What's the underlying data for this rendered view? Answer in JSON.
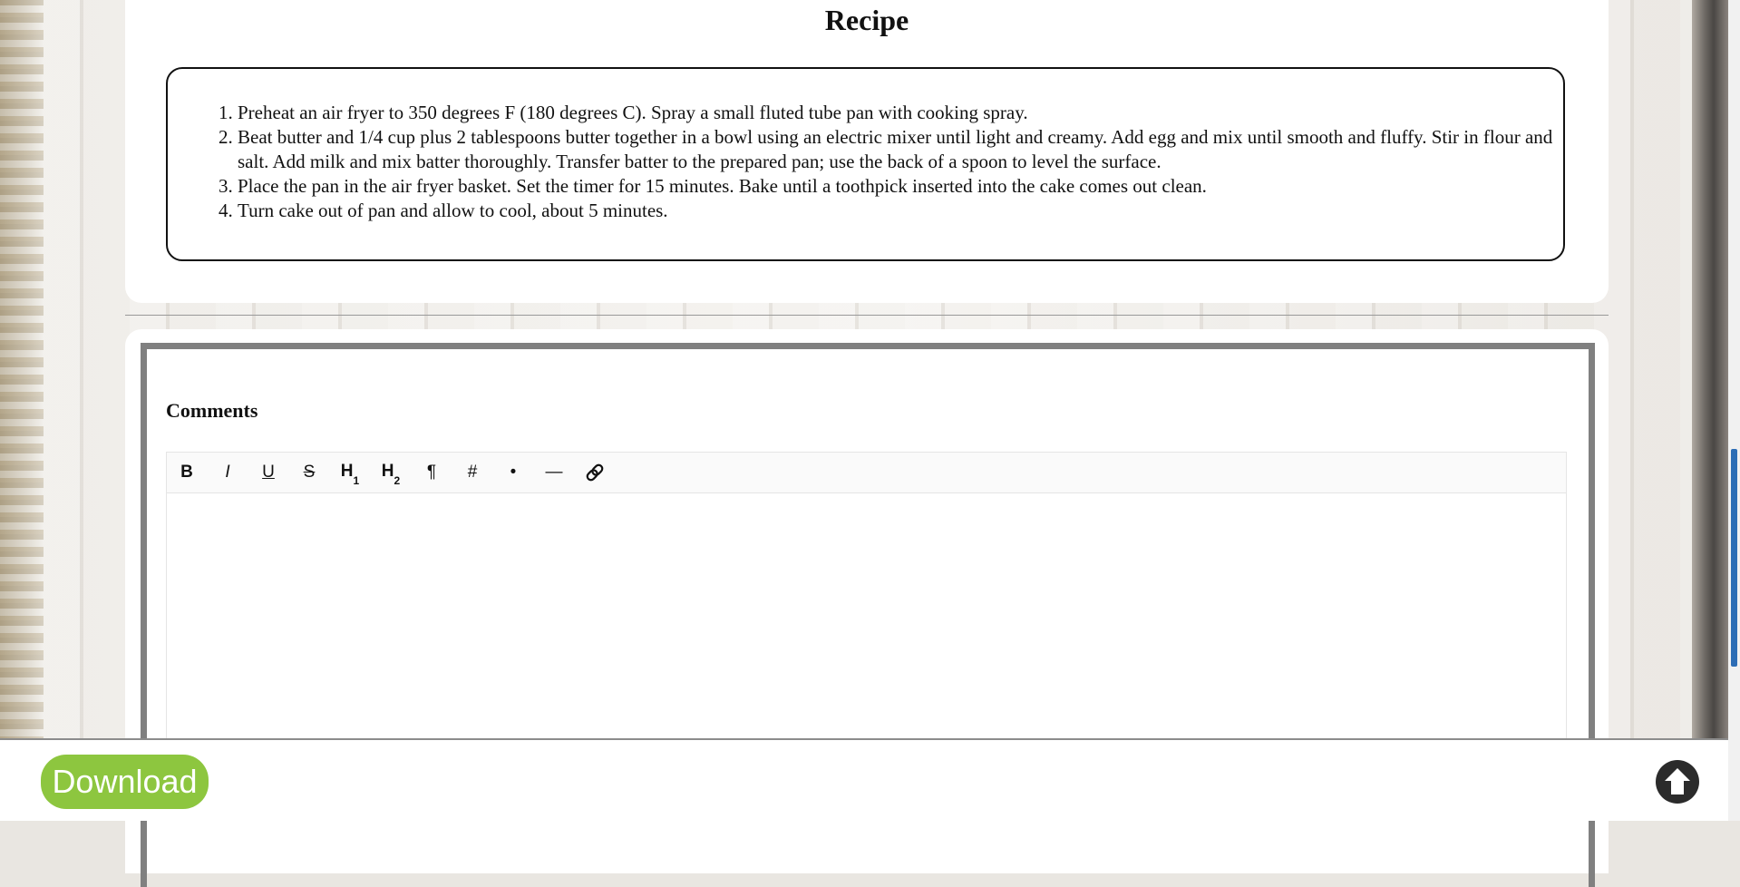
{
  "recipe": {
    "title": "Recipe",
    "steps": [
      "Preheat an air fryer to 350 degrees F (180 degrees C). Spray a small fluted tube pan with cooking spray.",
      "Beat butter and 1/4 cup plus 2 tablespoons butter together in a bowl using an electric mixer until light and creamy. Add egg and mix until smooth and fluffy. Stir in flour and salt. Add milk and mix batter thoroughly. Transfer batter to the prepared pan; use the back of a spoon to level the surface.",
      "Place the pan in the air fryer basket. Set the timer for 15 minutes. Bake until a toothpick inserted into the cake comes out clean.",
      "Turn cake out of pan and allow to cool, about 5 minutes."
    ]
  },
  "comments": {
    "heading": "Comments",
    "toolbar": [
      {
        "name": "bold-button",
        "label": "B",
        "icon": "bold-icon"
      },
      {
        "name": "italic-button",
        "label": "I",
        "icon": "italic-icon"
      },
      {
        "name": "underline-button",
        "label": "U",
        "icon": "underline-icon"
      },
      {
        "name": "strikethrough-button",
        "label": "S",
        "icon": "strikethrough-icon"
      },
      {
        "name": "heading1-button",
        "label": "H",
        "sub": "1",
        "icon": "heading1-icon"
      },
      {
        "name": "heading2-button",
        "label": "H",
        "sub": "2",
        "icon": "heading2-icon"
      },
      {
        "name": "paragraph-button",
        "label": "¶",
        "icon": "paragraph-icon"
      },
      {
        "name": "ordered-list-button",
        "label": "#",
        "icon": "hash-icon"
      },
      {
        "name": "bullet-list-button",
        "label": "•",
        "icon": "bullet-icon"
      },
      {
        "name": "horizontal-rule-button",
        "label": "—",
        "icon": "horizontal-rule-icon"
      },
      {
        "name": "link-button",
        "label": "",
        "icon": "link-icon"
      }
    ]
  },
  "footer": {
    "download_label": "Download",
    "scroll_top_icon": "arrow-up-icon"
  },
  "colors": {
    "download": "#8dc63f",
    "scroll_thumb": "#2d6db5"
  }
}
